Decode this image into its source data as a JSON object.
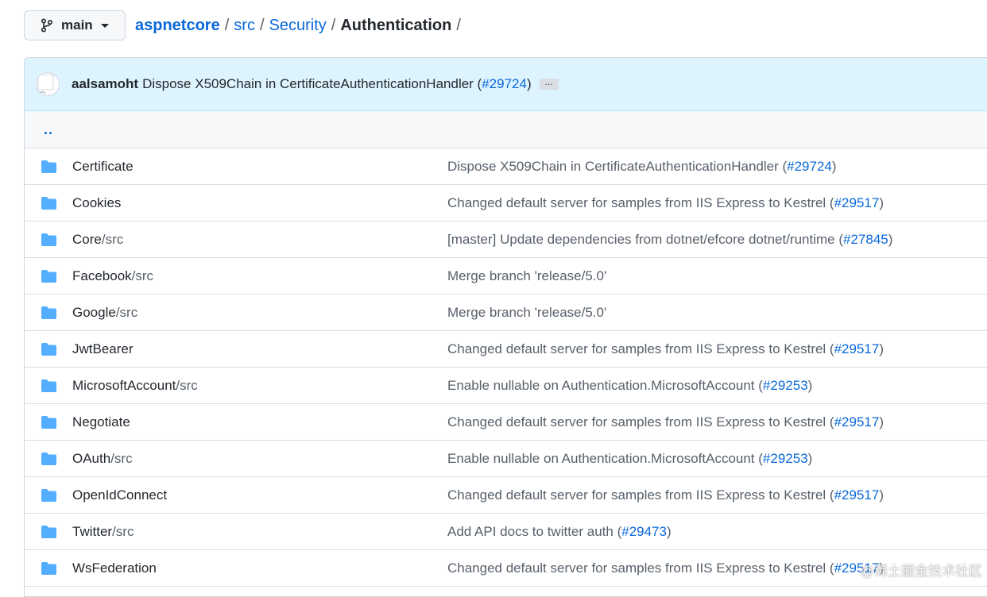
{
  "branch": {
    "name": "main"
  },
  "breadcrumb": {
    "root": "aspnetcore",
    "parts": [
      "src",
      "Security"
    ],
    "current": "Authentication",
    "sep": "/"
  },
  "commit": {
    "author": "aalsamoht",
    "message": "Dispose X509Chain in CertificateAuthenticationHandler (",
    "pr": "#29724",
    "close": ")",
    "more": "…"
  },
  "parent": "..",
  "rows": [
    {
      "name_main": "Certificate",
      "name_dim": "",
      "msg": "Dispose X509Chain in CertificateAuthenticationHandler (",
      "pr": "#29724",
      "close": ")"
    },
    {
      "name_main": "Cookies",
      "name_dim": "",
      "msg": "Changed default server for samples from IIS Express to Kestrel (",
      "pr": "#29517",
      "close": ")"
    },
    {
      "name_main": "Core",
      "name_dim": "/src",
      "msg": "[master] Update dependencies from dotnet/efcore dotnet/runtime (",
      "pr": "#27845",
      "close": ")"
    },
    {
      "name_main": "Facebook",
      "name_dim": "/src",
      "msg": "Merge branch 'release/5.0'",
      "pr": "",
      "close": ""
    },
    {
      "name_main": "Google",
      "name_dim": "/src",
      "msg": "Merge branch 'release/5.0'",
      "pr": "",
      "close": ""
    },
    {
      "name_main": "JwtBearer",
      "name_dim": "",
      "msg": "Changed default server for samples from IIS Express to Kestrel (",
      "pr": "#29517",
      "close": ")"
    },
    {
      "name_main": "MicrosoftAccount",
      "name_dim": "/src",
      "msg": "Enable nullable on Authentication.MicrosoftAccount (",
      "pr": "#29253",
      "close": ")"
    },
    {
      "name_main": "Negotiate",
      "name_dim": "",
      "msg": "Changed default server for samples from IIS Express to Kestrel (",
      "pr": "#29517",
      "close": ")"
    },
    {
      "name_main": "OAuth",
      "name_dim": "/src",
      "msg": "Enable nullable on Authentication.MicrosoftAccount (",
      "pr": "#29253",
      "close": ")"
    },
    {
      "name_main": "OpenIdConnect",
      "name_dim": "",
      "msg": "Changed default server for samples from IIS Express to Kestrel (",
      "pr": "#29517",
      "close": ")"
    },
    {
      "name_main": "Twitter",
      "name_dim": "/src",
      "msg": "Add API docs to twitter auth (",
      "pr": "#29473",
      "close": ")"
    },
    {
      "name_main": "WsFederation",
      "name_dim": "",
      "msg": "Changed default server for samples from IIS Express to Kestrel (",
      "pr": "#29517",
      "close": ")"
    }
  ],
  "watermark": "@稀土掘金技术社区",
  "colors": {
    "link": "#0969da",
    "folder": "#54aeff",
    "commit_bg": "#ddf4ff",
    "border": "#d0d7de"
  },
  "icons": {
    "branch": "git-branch-icon",
    "folder": "folder-icon",
    "caret": "caret-down-icon"
  }
}
